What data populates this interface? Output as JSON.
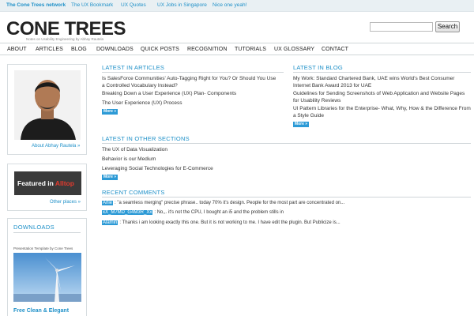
{
  "topbar": {
    "links": [
      "The Cone Trees network",
      "The UX Bookmark",
      "UX Quotes",
      "UX Jobs in Singapore",
      "Nice one yeah!"
    ]
  },
  "header": {
    "logo": "CONE TREES",
    "tagline": "Notes on Usability Engineering by Abhay Rautela",
    "search_button": "Search",
    "search_value": ""
  },
  "nav": {
    "items": [
      "ABOUT",
      "ARTICLES",
      "BLOG",
      "DOWNLOADS",
      "QUICK POSTS",
      "RECOGNITION",
      "TUTORIALS",
      "UX GLOSSARY",
      "CONTACT"
    ]
  },
  "sidebar": {
    "about_link": "About Abhay Rautela »",
    "badge_featured": "Featured in ",
    "badge_brand": "Alltop",
    "other_link": "Other places »",
    "downloads_title": "DOWNLOADS",
    "downloads_sub": "Presentation Template by Cone Trees",
    "downloads_caption": "Free Clean & Elegant"
  },
  "main": {
    "more_label": "More »",
    "articles": {
      "title": "LATEST IN ARTICLES",
      "items": [
        "Is SalesForce Communities' Auto-Tagging Right for You? Or Should You Use a Controlled Vocabulary Instead?",
        "Breaking Down a User Experience (UX) Plan- Components",
        "The User Experience (UX) Process"
      ]
    },
    "blog": {
      "title": "LATEST IN BLOG",
      "items": [
        "My Work: Standard Chartered Bank, UAE wins World's Best Consumer Internet Bank Award 2013 for UAE",
        "Guidelines for Sending Screenshots of Web Application and Website Pages for Usability Reviews",
        "UI Pattern Libraries for the Enterprise- What, Why, How & the Difference From a Style Guide"
      ]
    },
    "other": {
      "title": "LATEST IN OTHER SECTIONS",
      "items": [
        "The UX of Data Visualization",
        "Behavior is our Medium",
        "Leveraging Social Technologies for E-Commerce"
      ]
    },
    "comments": {
      "title": "RECENT COMMENTS",
      "items": [
        {
          "author": "Arlie",
          "text": ": \"a seamless merging\" precise phrase.. today 70% it's design. People for the most part are concentrated on..."
        },
        {
          "author": "xX_M7MD_G4M3R_Xx",
          "text": ": No,,. it's not the CPU, I bought an i5 and the problem stills in"
        },
        {
          "author": "Alamin",
          "text": ": Thanks i am looking exactly this one. But it is not working to me. I have edit the plugin. But Publicize is..."
        }
      ]
    }
  },
  "colors": {
    "accent": "#1e90c8",
    "button": "#2c9ad6",
    "topbar_bg": "#e9f0f3",
    "badge_highlight": "#e23a2e"
  }
}
